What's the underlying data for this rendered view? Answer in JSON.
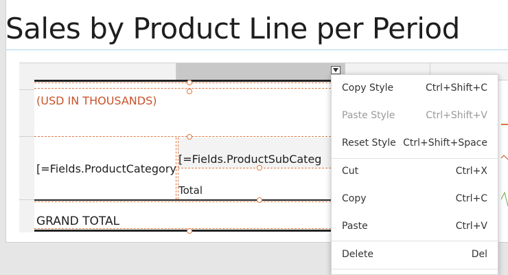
{
  "report": {
    "title": "Sales by Product Line per Period",
    "currency_note": "(USD IN THOUSANDS)",
    "category_field": "[=Fields.ProductCategory",
    "subcategory_field": "[=Fields.ProductSubCateg",
    "total_label": "Total",
    "grand_total_label": "GRAND TOTAL"
  },
  "context_menu": {
    "items": [
      {
        "label": "Copy Style",
        "shortcut": "Ctrl+Shift+C",
        "enabled": true
      },
      {
        "label": "Paste Style",
        "shortcut": "Ctrl+Shift+V",
        "enabled": false
      },
      {
        "label": "Reset Style",
        "shortcut": "Ctrl+Shift+Space",
        "enabled": true
      },
      {
        "label": "Cut",
        "shortcut": "Ctrl+X",
        "enabled": true
      },
      {
        "label": "Copy",
        "shortcut": "Ctrl+C",
        "enabled": true
      },
      {
        "label": "Paste",
        "shortcut": "Ctrl+V",
        "enabled": true
      },
      {
        "label": "Delete",
        "shortcut": "Del",
        "enabled": true
      }
    ]
  },
  "icons": {
    "column_menu": "chevron-down-icon"
  },
  "colors": {
    "selection_dash": "#e0753a",
    "accent_text": "#c8522a",
    "title_underline": "#a9d4ef"
  }
}
